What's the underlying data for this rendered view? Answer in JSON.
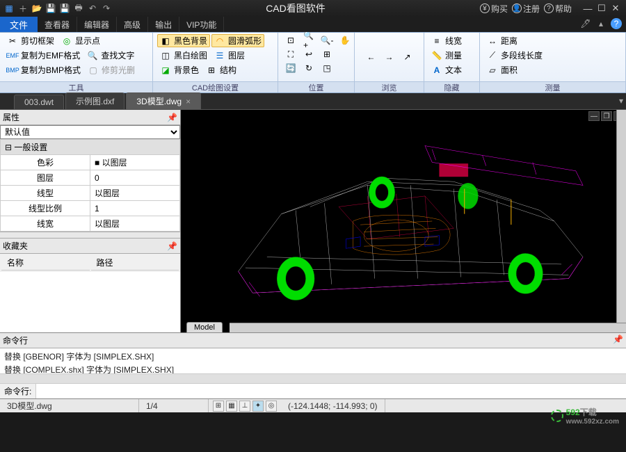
{
  "app": {
    "title": "CAD看图软件"
  },
  "titlebar": {
    "buy": "购买",
    "register": "注册",
    "help": "帮助"
  },
  "menu": {
    "file": "文件",
    "items": [
      "查看器",
      "编辑器",
      "高级",
      "输出",
      "VIP功能"
    ]
  },
  "ribbon": {
    "group_tools": {
      "label": "工具",
      "trim": "剪切框架",
      "showpoint": "显示点",
      "copy_emf": "复制为EMF格式",
      "findtext": "查找文字",
      "copy_bmp": "复制为BMP格式",
      "trimlight": "修剪光删"
    },
    "group_cad": {
      "label": "CAD绘图设置",
      "blackbg": "黑色背景",
      "smootharc": "圆滑弧形",
      "bwdraw": "黑白绘图",
      "layers": "图层",
      "bgcolor": "背景色",
      "struct": "结构"
    },
    "group_pos": {
      "label": "位置"
    },
    "group_browse": {
      "label": "浏览"
    },
    "group_hide": {
      "label": "隐藏"
    },
    "group_measure": {
      "label": "测量",
      "linewidth": "线宽",
      "distance": "距离",
      "measure": "测量",
      "polylen": "多段线长度",
      "text": "文本",
      "area": "面积"
    }
  },
  "tabs": {
    "items": [
      "003.dwt",
      "示例图.dxf",
      "3D模型.dwg"
    ],
    "active": 2
  },
  "props": {
    "title": "属性",
    "default": "默认值",
    "section": "一般设置",
    "rows": [
      {
        "k": "色彩",
        "v": "以图层"
      },
      {
        "k": "图层",
        "v": "0"
      },
      {
        "k": "线型",
        "v": "以图层"
      },
      {
        "k": "线型比例",
        "v": "1"
      },
      {
        "k": "线宽",
        "v": "以图层"
      }
    ]
  },
  "fav": {
    "title": "收藏夹",
    "col1": "名称",
    "col2": "路径"
  },
  "viewport": {
    "modeltab": "Model"
  },
  "cmd": {
    "title": "命令行",
    "lines": [
      "替换 [GBENOR] 字体为 [SIMPLEX.SHX]",
      "替换 [COMPLEX.shx] 字体为 [SIMPLEX.SHX]"
    ],
    "prompt": "命令行:"
  },
  "status": {
    "file": "3D模型.dwg",
    "scale": "1/4",
    "coords": "(-124.1448; -114.993; 0)"
  },
  "watermark": {
    "brand": "592",
    "suffix": "下载",
    "url": "www.592xz.com"
  }
}
